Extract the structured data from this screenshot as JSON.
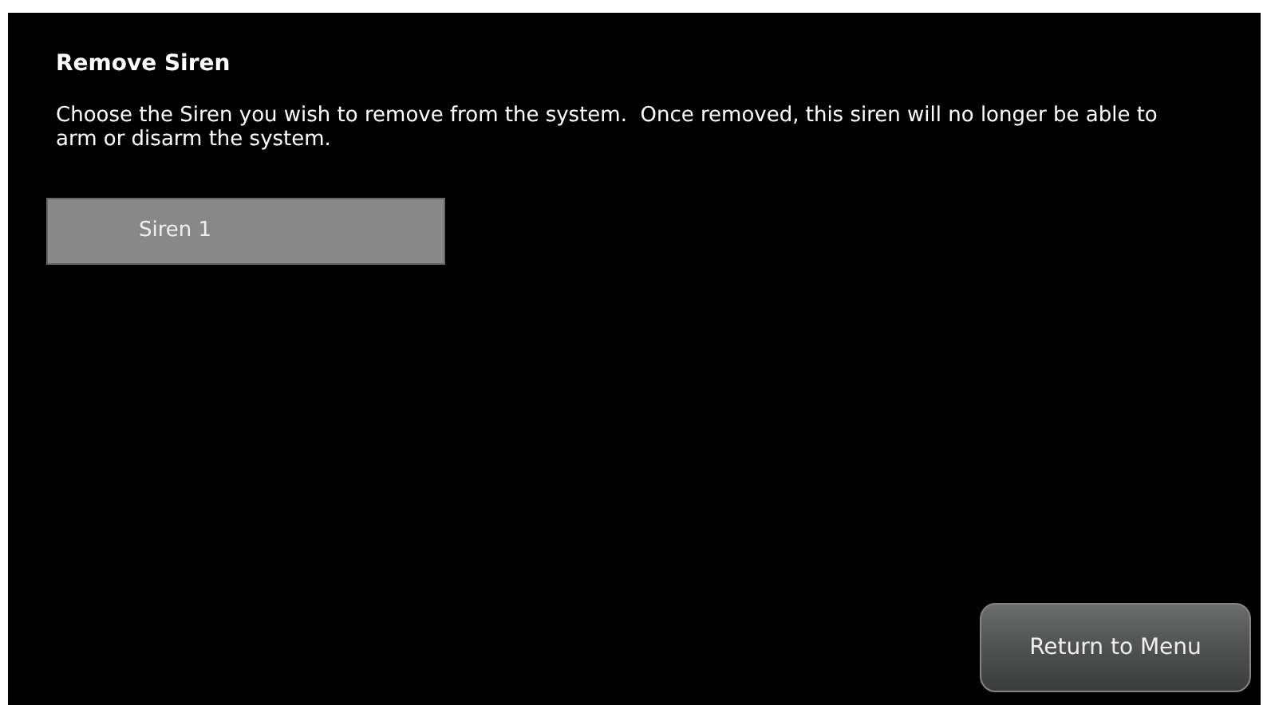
{
  "title": "Remove Siren",
  "description": "Choose the Siren you wish to remove from the system.  Once removed, this siren will no longer be able to arm or disarm the system.",
  "sirens": [
    {
      "label": "Siren 1"
    }
  ],
  "return_button": "Return to Menu"
}
